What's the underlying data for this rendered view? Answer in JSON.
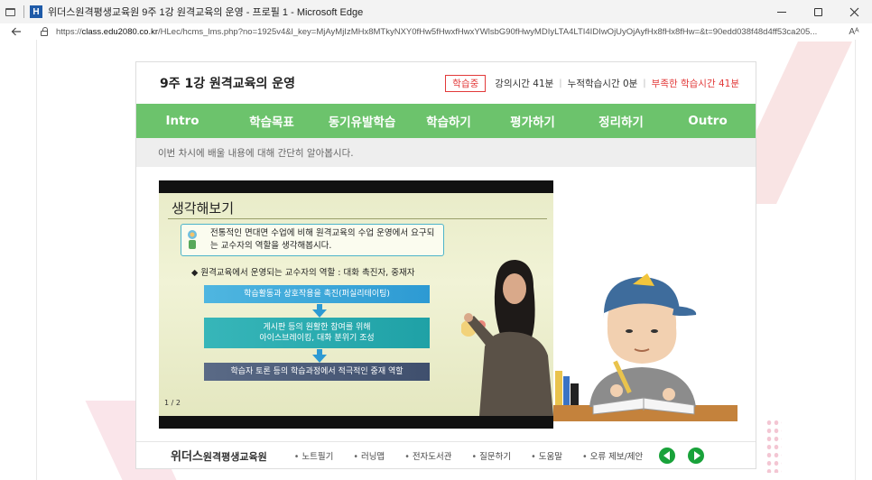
{
  "window": {
    "favicon_letter": "H",
    "title": "위더스원격평생교육원 9주 1강 원격교육의 운영 - 프로필 1 - Microsoft Edge"
  },
  "address": {
    "url_prefix": "https://",
    "url_domain": "class.edu2080.co.kr",
    "url_path": "/HLec/hcms_lms.php?no=1925v4&l_key=MjAyMjIzMHx8MTkyNXY0fHw5fHwxfHwxYWlsbG90fHwyMDIyLTA4LTI4IDIwOjUyOjAyfHx8fHx8fHw=&t=90edd038f48d4ff53ca205...",
    "reader_label": "Aᴬ"
  },
  "lesson": {
    "title": "9주 1강 원격교육의 운영",
    "status_badge": "학습중",
    "lecture_time": "강의시간 41분",
    "cumulative_time": "누적학습시간 0분",
    "missing_time": "부족한 학습시간 41분"
  },
  "nav": {
    "items": [
      "Intro",
      "학습목표",
      "동기유발학습",
      "학습하기",
      "평가하기",
      "정리하기",
      "Outro"
    ]
  },
  "subbar": {
    "text": "이번 차시에 배울 내용에 대해 간단히 알아봅시다."
  },
  "slide": {
    "title": "생각해보기",
    "box_text": "전통적인 면대면 수업에 비해 원격교육의 수업 운영에서 요구되는 교수자의 역할을 생각해봅시다.",
    "bullet": "◆ 원격교육에서 운영되는 교수자의 역할 : 대화 촉진자, 중재자",
    "bar1": "학습활동과 상호작용을 촉진(퍼실리테이팅)",
    "bar2_line1": "게시판 등의 원활한 참여를 위해",
    "bar2_line2": "아이스브레이킹, 대화 분위기 조성",
    "bar3": "학습자 토론 등의 학습과정에서 적극적인 중재 역할",
    "page": "1 / 2"
  },
  "footer": {
    "brand_main": "위더스",
    "brand_sub": "원격평생교육원",
    "links": [
      "노트필기",
      "러닝맵",
      "전자도서관",
      "질문하기",
      "도움말",
      "오류 제보/제안"
    ]
  },
  "colors": {
    "nav_green": "#6cc36c",
    "alert_red": "#e23a3a",
    "button_green": "#19a23a"
  }
}
